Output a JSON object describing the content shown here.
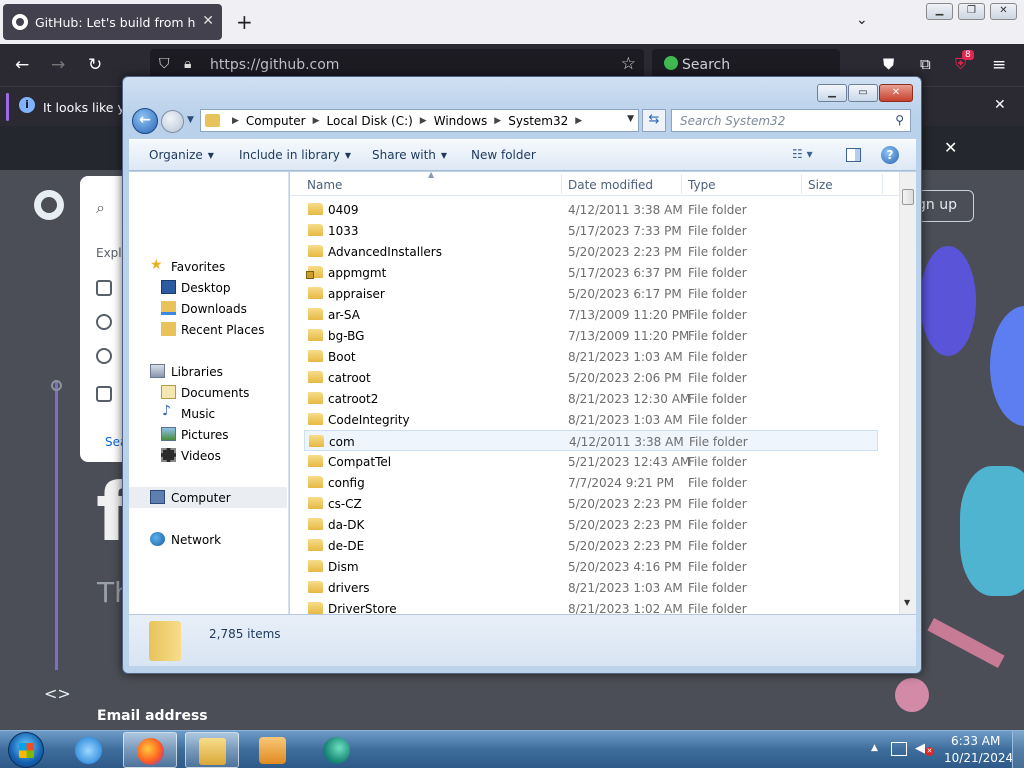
{
  "browser": {
    "tab_title": "GitHub: Let's build from here · G",
    "url": "https://github.com",
    "search_placeholder": "Search",
    "extension_badge": "8",
    "notification": "It looks like you"
  },
  "github_page": {
    "sign_up": "gn up",
    "explore": "Explo",
    "search_link": "Sea",
    "hero_letter": "f",
    "subtitle_start": "Th",
    "email_label": "Email address"
  },
  "explorer": {
    "breadcrumbs": [
      "Computer",
      "Local Disk (C:)",
      "Windows",
      "System32"
    ],
    "search_placeholder": "Search System32",
    "toolbar": {
      "organize": "Organize",
      "include_in_library": "Include in library",
      "share_with": "Share with",
      "new_folder": "New folder"
    },
    "nav": {
      "favorites": "Favorites",
      "desktop": "Desktop",
      "downloads": "Downloads",
      "recent_places": "Recent Places",
      "libraries": "Libraries",
      "documents": "Documents",
      "music": "Music",
      "pictures": "Pictures",
      "videos": "Videos",
      "computer": "Computer",
      "network": "Network"
    },
    "columns": {
      "name": "Name",
      "date_modified": "Date modified",
      "type": "Type",
      "size": "Size"
    },
    "files": [
      {
        "name": "0409",
        "date": "4/12/2011 3:38 AM",
        "type": "File folder"
      },
      {
        "name": "1033",
        "date": "5/17/2023 7:33 PM",
        "type": "File folder"
      },
      {
        "name": "AdvancedInstallers",
        "date": "5/20/2023 2:23 PM",
        "type": "File folder"
      },
      {
        "name": "appmgmt",
        "date": "5/17/2023 6:37 PM",
        "type": "File folder"
      },
      {
        "name": "appraiser",
        "date": "5/20/2023 6:17 PM",
        "type": "File folder"
      },
      {
        "name": "ar-SA",
        "date": "7/13/2009 11:20 PM",
        "type": "File folder"
      },
      {
        "name": "bg-BG",
        "date": "7/13/2009 11:20 PM",
        "type": "File folder"
      },
      {
        "name": "Boot",
        "date": "8/21/2023 1:03 AM",
        "type": "File folder"
      },
      {
        "name": "catroot",
        "date": "5/20/2023 2:06 PM",
        "type": "File folder"
      },
      {
        "name": "catroot2",
        "date": "8/21/2023 12:30 AM",
        "type": "File folder"
      },
      {
        "name": "CodeIntegrity",
        "date": "8/21/2023 1:03 AM",
        "type": "File folder"
      },
      {
        "name": "com",
        "date": "4/12/2011 3:38 AM",
        "type": "File folder"
      },
      {
        "name": "CompatTel",
        "date": "5/21/2023 12:43 AM",
        "type": "File folder"
      },
      {
        "name": "config",
        "date": "7/7/2024 9:21 PM",
        "type": "File folder"
      },
      {
        "name": "cs-CZ",
        "date": "5/20/2023 2:23 PM",
        "type": "File folder"
      },
      {
        "name": "da-DK",
        "date": "5/20/2023 2:23 PM",
        "type": "File folder"
      },
      {
        "name": "de-DE",
        "date": "5/20/2023 2:23 PM",
        "type": "File folder"
      },
      {
        "name": "Dism",
        "date": "5/20/2023 4:16 PM",
        "type": "File folder"
      },
      {
        "name": "drivers",
        "date": "8/21/2023 1:03 AM",
        "type": "File folder"
      },
      {
        "name": "DriverStore",
        "date": "8/21/2023 1:02 AM",
        "type": "File folder"
      }
    ],
    "status_count": "2,785 items"
  },
  "taskbar": {
    "clock_time": "6:33 AM",
    "clock_date": "10/21/2024"
  }
}
